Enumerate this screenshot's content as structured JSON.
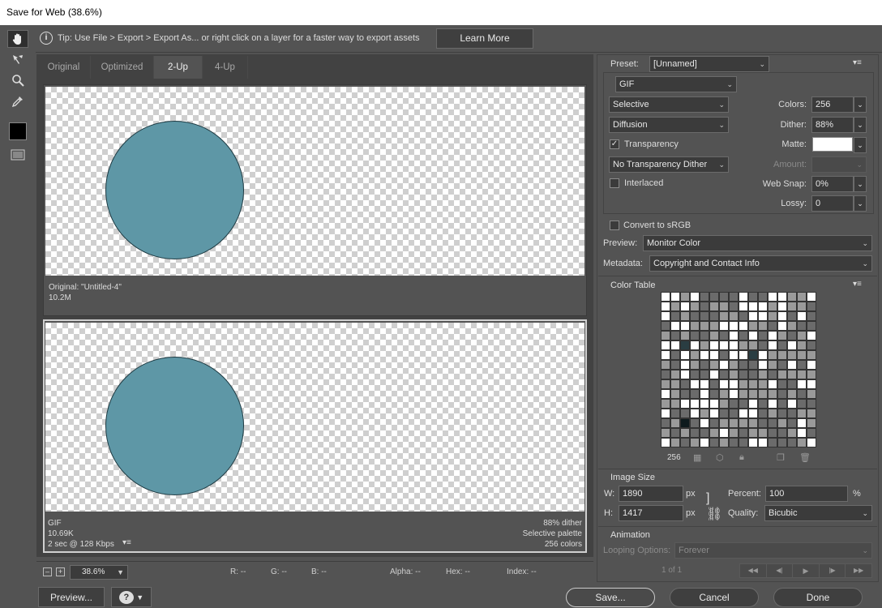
{
  "window": {
    "title": "Save for Web (38.6%)"
  },
  "tip": {
    "text": "Tip: Use File > Export > Export As...  or right click on a layer for a faster way to export assets",
    "learn_more": "Learn More"
  },
  "tabs": [
    "Original",
    "Optimized",
    "2-Up",
    "4-Up"
  ],
  "active_tab": "2-Up",
  "panes": {
    "original": {
      "line1": "Original: \"Untitled-4\"",
      "line2": "10.2M"
    },
    "optimized": {
      "format": "GIF",
      "size": "10.69K",
      "speed": "2 sec @ 128 Kbps",
      "dither": "88% dither",
      "palette": "Selective palette",
      "colors": "256 colors"
    }
  },
  "circle_color": "#5e97a6",
  "bottom": {
    "zoom": "38.6%",
    "r": "R: --",
    "g": "G: --",
    "b": "B: --",
    "alpha": "Alpha: --",
    "hex": "Hex: --",
    "index": "Index: --"
  },
  "buttons": {
    "preview": "Preview...",
    "save": "Save...",
    "cancel": "Cancel",
    "done": "Done"
  },
  "settings": {
    "preset_label": "Preset:",
    "preset": "[Unnamed]",
    "format": "GIF",
    "reduction": "Selective",
    "dither_algo": "Diffusion",
    "transparency": "Transparency",
    "transparency_checked": true,
    "transparency_dither": "No Transparency Dither",
    "interlaced": "Interlaced",
    "interlaced_checked": false,
    "colors_label": "Colors:",
    "colors": "256",
    "dither_label": "Dither:",
    "dither": "88%",
    "matte_label": "Matte:",
    "matte_color": "#ffffff",
    "amount_label": "Amount:",
    "websnap_label": "Web Snap:",
    "websnap": "0%",
    "lossy_label": "Lossy:",
    "lossy": "0",
    "convert_srgb": "Convert to sRGB",
    "preview_label": "Preview:",
    "preview": "Monitor Color",
    "metadata_label": "Metadata:",
    "metadata": "Copyright and Contact Info"
  },
  "color_table": {
    "title": "Color Table",
    "count": "256"
  },
  "image_size": {
    "title": "Image Size",
    "w_label": "W:",
    "w": "1890",
    "h_label": "H:",
    "h": "1417",
    "unit": "px",
    "percent_label": "Percent:",
    "percent": "100",
    "percent_unit": "%",
    "quality_label": "Quality:",
    "quality": "Bicubic"
  },
  "animation": {
    "title": "Animation",
    "looping_label": "Looping Options:",
    "looping": "Forever",
    "frame": "1 of 1"
  }
}
